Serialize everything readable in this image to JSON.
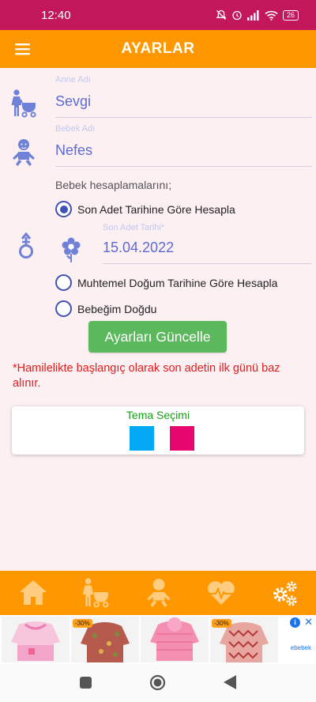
{
  "status_bar": {
    "time": "12:40",
    "battery": "26"
  },
  "app_bar": {
    "title": "AYARLAR",
    "menu_icon": "hamburger-menu-icon"
  },
  "form": {
    "mother_name": {
      "label": "Anne Adı",
      "value": "Sevgi",
      "icon": "mother-stroller-icon"
    },
    "baby_name": {
      "label": "Bebek Adı",
      "value": "Nefes",
      "icon": "baby-icon"
    },
    "calculation_heading": "Bebek hesaplamalarını;",
    "options": [
      {
        "label": "Son Adet Tarihine Göre Hesapla",
        "checked": true
      },
      {
        "label": "Muhtemel Doğum Tarihine Göre Hesapla",
        "checked": false
      },
      {
        "label": "Bebeğim Doğdu",
        "checked": false
      }
    ],
    "last_period_date": {
      "label": "Son Adet Tarihi*",
      "value": "15.04.2022",
      "icon": "flower-icon"
    },
    "gender_icon": "gender-symbol-icon",
    "update_button": "Ayarları Güncelle",
    "note": "*Hamilelikte başlangıç olarak son adetin ilk günü baz alınır."
  },
  "theme": {
    "title": "Tema Seçimi",
    "swatches": [
      {
        "name": "blue",
        "color": "#03a9f4"
      },
      {
        "name": "pink",
        "color": "#e6086e"
      }
    ]
  },
  "bottom_nav": [
    "home-icon",
    "mother-stroller-icon",
    "baby-icon",
    "heartbeat-icon",
    "settings-gears-icon"
  ],
  "ad": {
    "badges": [
      "-30%",
      "-30%"
    ],
    "brand": "ebebek",
    "info_icon": "info-icon",
    "close_icon": "close-icon"
  },
  "colors": {
    "status_bar": "#c2185b",
    "app_bar": "#ff9800",
    "accent_text": "#5b6bd4",
    "radio": "#3f51b5",
    "button": "#5cb85c",
    "note": "#e41b1b",
    "theme_title": "#18a018"
  }
}
